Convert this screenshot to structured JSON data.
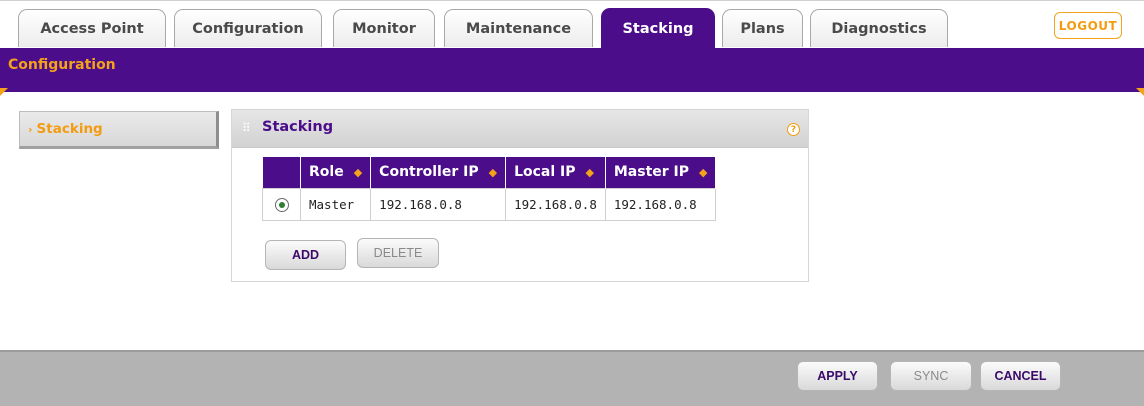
{
  "tabs": [
    {
      "label": "Access Point",
      "active": false
    },
    {
      "label": "Configuration",
      "active": false
    },
    {
      "label": "Monitor",
      "active": false
    },
    {
      "label": "Maintenance",
      "active": false
    },
    {
      "label": "Stacking",
      "active": true
    },
    {
      "label": "Plans",
      "active": false
    },
    {
      "label": "Diagnostics",
      "active": false
    }
  ],
  "logout_label": "LOGOUT",
  "subnav": {
    "label": "Configuration"
  },
  "leftnav": {
    "item_label": "Stacking"
  },
  "panel": {
    "title": "Stacking",
    "help_icon": "?",
    "table": {
      "headers": [
        "Role",
        "Controller IP",
        "Local IP",
        "Master IP"
      ],
      "rows": [
        {
          "selected": true,
          "role": "Master",
          "controller_ip": "192.168.0.8",
          "local_ip": "192.168.0.8",
          "master_ip": "192.168.0.8"
        }
      ]
    },
    "add_label": "ADD",
    "delete_label": "DELETE"
  },
  "footer": {
    "apply_label": "APPLY",
    "sync_label": "SYNC",
    "cancel_label": "CANCEL"
  },
  "colors": {
    "brand_purple": "#4b0d8a",
    "accent_orange": "#f5a21b"
  }
}
